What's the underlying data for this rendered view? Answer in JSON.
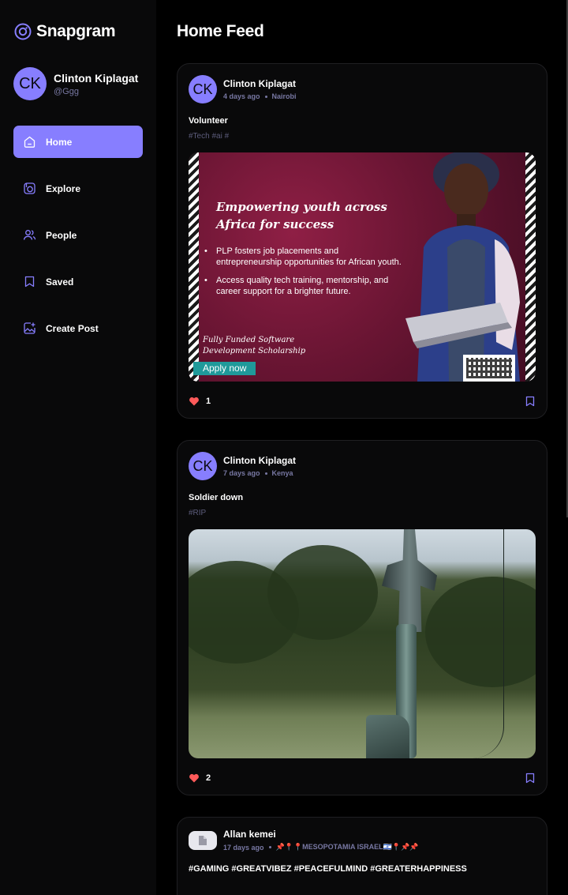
{
  "brand": {
    "name": "Snapgram"
  },
  "profile": {
    "initials": "CK",
    "name": "Clinton Kiplagat",
    "handle": "@Ggg"
  },
  "nav": [
    {
      "label": "Home",
      "icon": "home-icon",
      "active": true
    },
    {
      "label": "Explore",
      "icon": "explore-icon",
      "active": false
    },
    {
      "label": "People",
      "icon": "people-icon",
      "active": false
    },
    {
      "label": "Saved",
      "icon": "bookmark-icon",
      "active": false
    },
    {
      "label": "Create Post",
      "icon": "image-add-icon",
      "active": false
    }
  ],
  "page": {
    "title": "Home Feed"
  },
  "posts": [
    {
      "initials": "CK",
      "author": "Clinton Kiplagat",
      "time": "4 days ago",
      "location": "Nairobi",
      "caption": "Volunteer",
      "tags": "#Tech #ai #",
      "likes": "1",
      "flyer": {
        "headline_1": "Empowering youth across",
        "headline_2": "Africa for success",
        "bullet_1": "PLP fosters job placements and entrepreneurship opportunities for African youth.",
        "bullet_2": "Access quality tech training, mentorship, and career support for a brighter future.",
        "foot_1": "Fully Funded Software",
        "foot_2": "Development Scholarship",
        "apply": "Apply now"
      }
    },
    {
      "initials": "CK",
      "author": "Clinton Kiplagat",
      "time": "7 days ago",
      "location": "Kenya",
      "caption": "Soldier down",
      "tags": "#RIP",
      "likes": "2"
    },
    {
      "author": "Allan kemei",
      "time": "17 days ago",
      "location": "📌📍📍MESOPOTAMIA ISRAEL🇮🇱📍📌📌",
      "caption": "#GAMING #GREATVIBEZ #PEACEFULMIND #GREATERHAPPINESS"
    }
  ],
  "colors": {
    "accent": "#877eff",
    "secondary_text": "#7878a3",
    "tag_text": "#5c5c7b",
    "heart": "#ff5a5a"
  }
}
